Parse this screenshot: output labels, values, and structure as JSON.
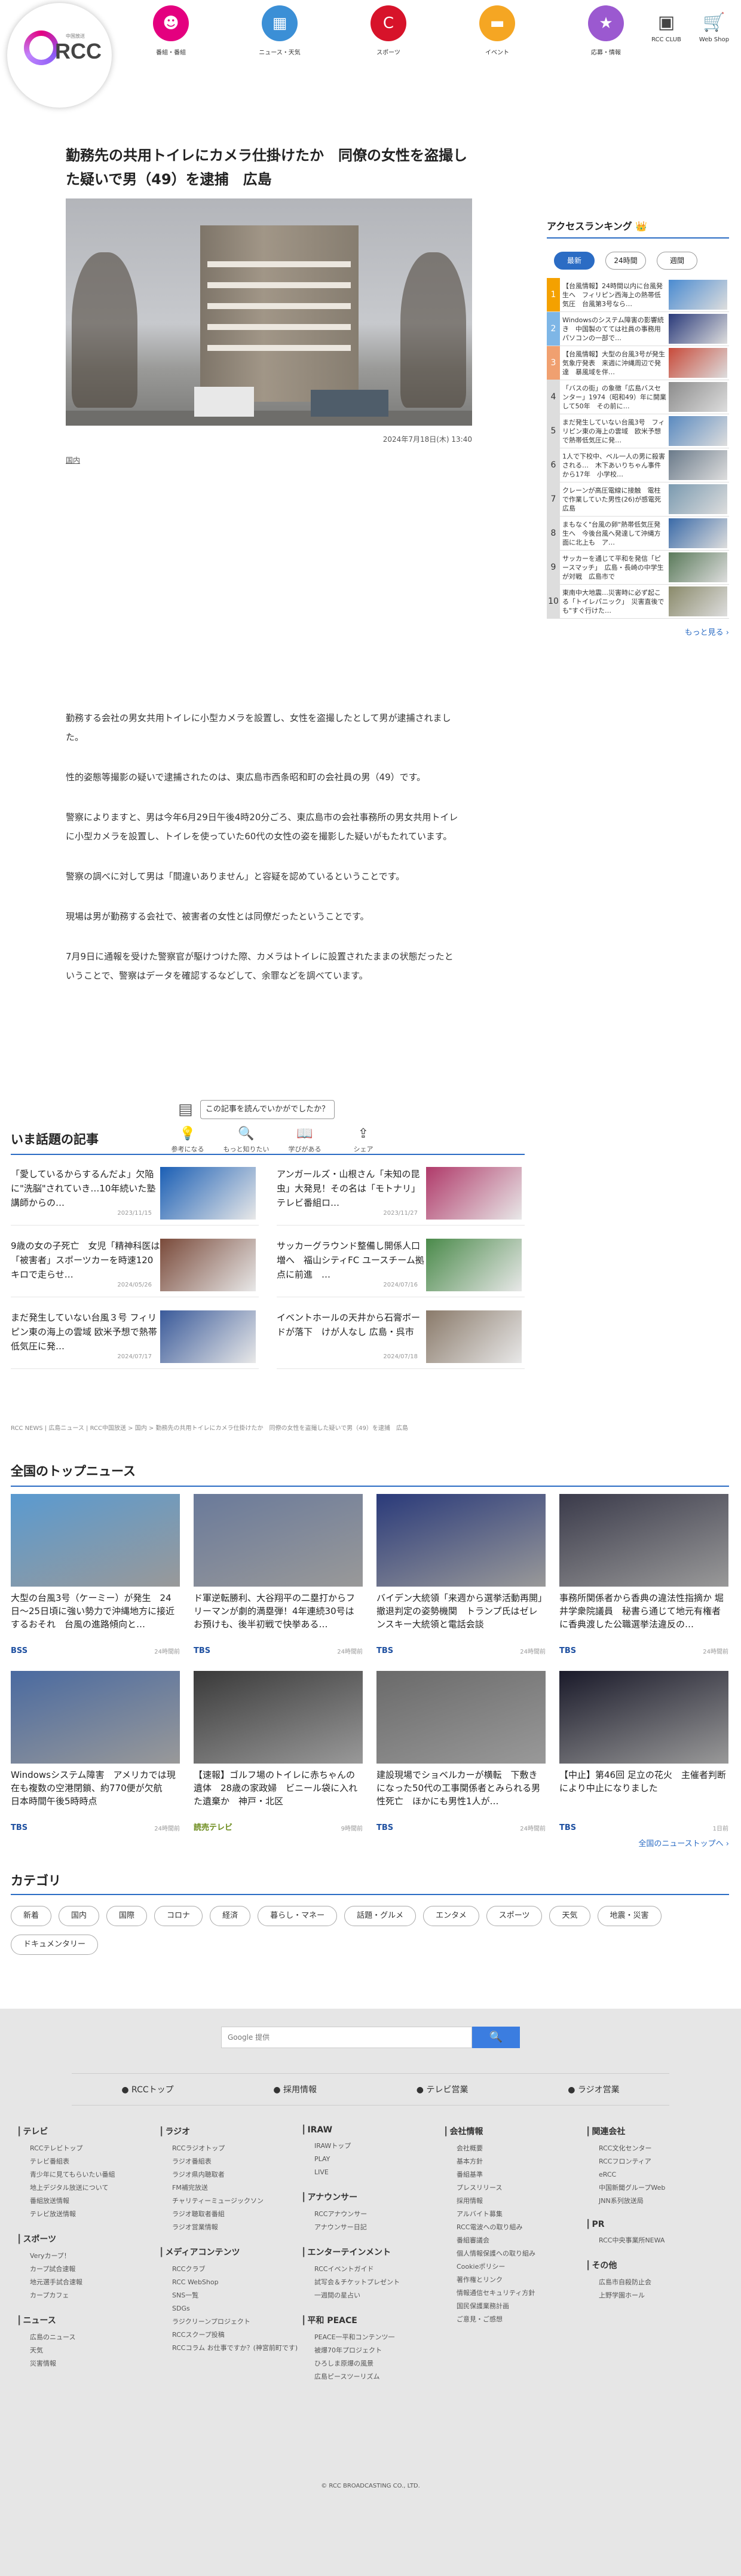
{
  "header": {
    "logo_text": "RCC",
    "logo_sub": "中国放送",
    "nav": [
      {
        "label": "番組・番組",
        "icon": "tv-icon",
        "color": "#e4007f"
      },
      {
        "label": "ニュース・天気",
        "icon": "news-icon",
        "color": "#3b8fd6"
      },
      {
        "label": "スポーツ",
        "icon": "carp-icon",
        "color": "#d7132a"
      },
      {
        "label": "イベント",
        "icon": "ticket-icon",
        "color": "#f5a623"
      },
      {
        "label": "応募・情報",
        "icon": "star-icon",
        "color": "#9b59d0"
      }
    ],
    "util": [
      {
        "label": "RCC CLUB",
        "icon": "▣"
      },
      {
        "label": "Web Shop",
        "icon": "🛒"
      }
    ]
  },
  "article": {
    "headline": "勤務先の共用トイレにカメラ仕掛けたか　同僚の女性を盗撮した疑いで男（49）を逮捕　広島",
    "date": "2024年7月18日(木) 13:40",
    "category": "国内",
    "paragraphs": [
      "勤務する会社の男女共用トイレに小型カメラを設置し、女性を盗撮したとして男が逮捕されました。",
      "性的姿態等撮影の疑いで逮捕されたのは、東広島市西条昭和町の会社員の男（49）です。",
      "警察によりますと、男は今年6月29日午後4時20分ごろ、東広島市の会社事務所の男女共用トイレに小型カメラを設置し、トイレを使っていた60代の女性の姿を撮影した疑いがもたれています。",
      "警察の調べに対して男は「間違いありません」と容疑を認めているということです。",
      "現場は男が勤務する会社で、被害者の女性とは同僚だったということです。",
      "7月9日に通報を受けた警察官が駆けつけた際、カメラはトイレに設置されたままの状態だったということで、警察はデータを確認するなどして、余罪などを調べています。"
    ],
    "reaction_question": "この記事を読んでいかがでしたか？",
    "reactions": [
      {
        "label": "参考になる",
        "icon": "💡"
      },
      {
        "label": "もっと知りたい",
        "icon": "🔍"
      },
      {
        "label": "学びがある",
        "icon": "📖"
      },
      {
        "label": "シェア",
        "icon": "⇪"
      }
    ]
  },
  "ranking": {
    "title": "アクセスランキング",
    "title_icon": "👑",
    "tabs": [
      "最新",
      "24時間",
      "週間"
    ],
    "items": [
      {
        "num": "1",
        "text": "【台風情報】24時間以内に台風発生へ　フィリピン西海上の熱帯低気圧　台風第3号なら…",
        "color": "#f4a100",
        "thumb": "#4a8bd1"
      },
      {
        "num": "2",
        "text": "Windowsのシステム障害の影響続き　中国製のてては社員の事務用パソコンの一部で…",
        "color": "#7eb6e6",
        "thumb": "#2a3a7a"
      },
      {
        "num": "3",
        "text": "【台風情報】大型の台風3号が発生　気象庁発表　来週に沖縄周辺で発達　暴風域を伴…",
        "color": "#f0a070",
        "thumb": "#c84a3a"
      },
      {
        "num": "4",
        "text": "「バスの街」の象徴「広島バスセンター」1974（昭和49）年に開業して50年　その前に…",
        "color": "#ddd",
        "thumb": "#8c8c8c"
      },
      {
        "num": "5",
        "text": "まだ発生していない台風3号　フィリピン東の海上の雲域　欧米予想で熱帯低気圧に発…",
        "color": "#ddd",
        "thumb": "#5a8ac0"
      },
      {
        "num": "6",
        "text": "1人で下校中、ベル一人の男に殺害される…　木下あいりちゃん事件から17年　小学校…",
        "color": "#ddd",
        "thumb": "#6a7a8a"
      },
      {
        "num": "7",
        "text": "クレーンが高圧電線に接触　電柱で作業していた男性(26)が感電死　広島",
        "color": "#ddd",
        "thumb": "#7a9ab0"
      },
      {
        "num": "8",
        "text": "まもなく\"台風の卵\"熱帯低気圧発生へ　今後台風へ発達して沖縄方面に北上も　ア…",
        "color": "#ddd",
        "thumb": "#3a6aa8"
      },
      {
        "num": "9",
        "text": "サッカーを通じて平和を発信「ピースマッチ」　広島・長崎の中学生が対戦　広島市で",
        "color": "#ddd",
        "thumb": "#5a7a5a"
      },
      {
        "num": "10",
        "text": "東南中大地震…災害時に必ず起こる「トイレパニック」　災害直後でも\"すぐ行けた…",
        "color": "#ddd",
        "thumb": "#8a8a6a"
      }
    ],
    "more": "もっと見る ›"
  },
  "topics": {
    "title": "いま話題の記事",
    "items": [
      {
        "title": "「愛しているからするんだよ」欠陥に\"洗脳\"されていき…10年続いた塾講師からの…",
        "date": "2023/11/15",
        "img": "#1b5fb5"
      },
      {
        "title": "アンガールズ・山根さん「未知の昆虫」大発見！その名は「モトナリ」 テレビ番組ロ…",
        "date": "2023/11/27",
        "img": "#b03a6a"
      },
      {
        "title": "9歳の女の子死亡　女児「精神科医は「被害者」スポーツカーを時速120キロで走らせ…",
        "date": "2024/05/26",
        "img": "#7a4a3a"
      },
      {
        "title": "サッカーグラウンド整備し開係人口増へ　福山シティFC ユースチーム拠点に前進　…",
        "date": "2024/07/16",
        "img": "#4a8a4a"
      },
      {
        "title": "まだ発生していない台風３号 フィリピン東の海上の雲域 欧米予想で熱帯低気圧に発…",
        "date": "2024/07/17",
        "img": "#3a5a9a"
      },
      {
        "title": "イベントホールの天井から石膏ボードが落下　けが人なし 広島・呉市",
        "date": "2024/07/18",
        "img": "#8a7a6a"
      }
    ]
  },
  "breadcrumb": "RCC NEWS | 広島ニュース | RCC中国放送 > 国内 > 勤務先の共用トイレにカメラ仕掛けたか　同僚の女性を盗撮した疑いで男（49）を逮捕　広島",
  "national": {
    "title": "全国のトップニュース",
    "items": [
      {
        "title": "大型の台風3号（ケーミー）が発生　24日～25日頃に強い勢力で沖縄地方に接近するおそれ　台風の進路傾向と…",
        "src": "BSS",
        "time": "24時間前",
        "img": "#5a9ad0",
        "src_color": "#1d4fa0"
      },
      {
        "title": "ド軍逆転勝利、大谷翔平の二塁打からフリーマンが劇的満塁弾！4年連続30号はお預けも、後半初戦で快挙ある…",
        "src": "TBS",
        "time": "24時間前",
        "img": "#6a7a9a",
        "src_color": "#1d4fa0"
      },
      {
        "title": "バイデン大統領「来週から選挙活動再開」撤退判定の姿勢機関　トランプ氏はゼレンスキー大統領と電話会談",
        "src": "TBS",
        "time": "24時間前",
        "img": "#2a3a7a",
        "src_color": "#1d4fa0"
      },
      {
        "title": "事務所関係者から香典の違法性指摘か 堀井学衆院議員　秘書ら通じて地元有権者に香典渡した公職選挙法違反の…",
        "src": "TBS",
        "time": "24時間前",
        "img": "#3a3a4a",
        "src_color": "#1d4fa0"
      },
      {
        "title": "Windowsシステム障害　アメリカでは現在も複数の空港閉鎖、約770便が欠航　日本時間午後5時時点",
        "src": "TBS",
        "time": "24時間前",
        "img": "#4a6aa0",
        "src_color": "#1d4fa0"
      },
      {
        "title": "【速報】ゴルフ場のトイレに赤ちゃんの遺体　28歳の家政婦　ビニール袋に入れた遺棄か　神戸・北区",
        "src": "読売テレビ",
        "time": "9時間前",
        "img": "#3a3a3a",
        "src_color": "#6a8a1a"
      },
      {
        "title": "建設現場でショベルカーが横転　下敷きになった50代の工事関係者とみられる男性死亡　ほかにも男性1人が…",
        "src": "TBS",
        "time": "24時間前",
        "img": "#6a6a6a",
        "src_color": "#1d4fa0"
      },
      {
        "title": "【中止】第46回 足立の花火　主催者判断により中止になりました",
        "src": "TBS",
        "time": "1日前",
        "img": "#1a1a2a",
        "src_color": "#1d4fa0"
      }
    ],
    "more": "全国のニューストップへ ›"
  },
  "category": {
    "title": "カテゴリ",
    "items": [
      "新着",
      "国内",
      "国際",
      "コロナ",
      "経済",
      "暮らし・マネー",
      "話題・グルメ",
      "エンタメ",
      "スポーツ",
      "天気",
      "地震・災害",
      "ドキュメンタリー"
    ]
  },
  "footer": {
    "search_placeholder": "Google 提供",
    "search_icon": "🔍",
    "links": [
      "● RCCトップ",
      "● 採用情報",
      "● テレビ営業",
      "● ラジオ営業"
    ],
    "columns": [
      [
        {
          "h": "テレビ",
          "items": [
            "RCCテレビトップ",
            "テレビ番組表",
            "青少年に見てもらいたい番組",
            "地上デジタル放送について",
            "番組放送情報",
            "テレビ放送情報"
          ]
        },
        {
          "h": "スポーツ",
          "items": [
            "Veryカープ！",
            "カープ試合速報",
            "地元選手試合速報",
            "カープカフェ"
          ]
        },
        {
          "h": "ニュース",
          "items": [
            "広島のニュース",
            "天気",
            "災害情報"
          ]
        }
      ],
      [
        {
          "h": "ラジオ",
          "items": [
            "RCCラジオトップ",
            "ラジオ番組表",
            "ラジオ県内聴取者",
            "FM補完放送",
            "チャリティーミュージックソン",
            "ラジオ聴取者番組",
            "ラジオ営業情報"
          ]
        },
        {
          "h": "メディアコンテンツ",
          "items": [
            "RCCクラブ",
            "RCC WebShop",
            "SNS一覧",
            "SDGs",
            "ラジクリーンプロジェクト",
            "RCCスクープ投稿",
            "RCCコラム お仕事ですか？(神宮前町です)"
          ]
        }
      ],
      [
        {
          "h": "IRAW",
          "items": [
            "IRAWトップ",
            "PLAY",
            "LIVE"
          ]
        },
        {
          "h": "アナウンサー",
          "items": [
            "RCCアナウンサー",
            "アナウンサー日記"
          ]
        },
        {
          "h": "エンターテインメント",
          "items": [
            "RCCイベントガイド",
            "試写会＆チケットプレゼント",
            "一週間の星占い"
          ]
        },
        {
          "h": "平和 PEACE",
          "items": [
            "PEACE一平和コンテンツ一",
            "被爆70年プロジェクト",
            "ひろしま原爆の風景",
            "広島ピースツーリズム"
          ]
        }
      ],
      [
        {
          "h": "会社情報",
          "items": [
            "会社概要",
            "基本方針",
            "番組基準",
            "プレスリリース",
            "採用情報",
            "アルバイト募集",
            "RCC電波への取り組み",
            "番組審議会",
            "個人情報保護への取り組み",
            "Cookieポリシー",
            "著作権とリンク",
            "情報通信セキュリティ方針",
            "国民保護業務計画",
            "ご意見・ご感想"
          ]
        }
      ],
      [
        {
          "h": "関連会社",
          "items": [
            "RCC文化センター",
            "RCCフロンティア",
            "eRCC",
            "中国新聞グループWeb",
            "JNN系列放送局"
          ]
        },
        {
          "h": "PR",
          "items": [
            "RCC中央事業所NEWA"
          ]
        },
        {
          "h": "その他",
          "items": [
            "広島市自殺防止会",
            "上野学園ホール"
          ]
        }
      ]
    ],
    "copyright": "© RCC BROADCASTING CO., LTD."
  }
}
